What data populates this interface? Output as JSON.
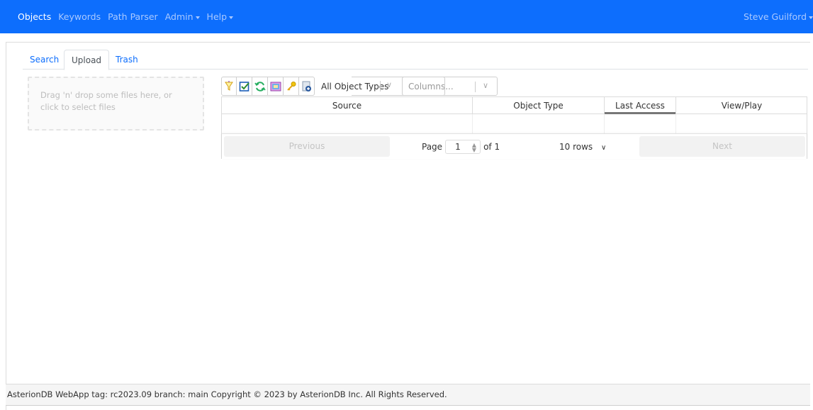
{
  "navbar": {
    "items": [
      {
        "label": "Objects",
        "active": true
      },
      {
        "label": "Keywords",
        "active": false
      },
      {
        "label": "Path Parser",
        "active": false
      },
      {
        "label": "Admin",
        "active": false,
        "dropdown": true
      },
      {
        "label": "Help",
        "active": false,
        "dropdown": true
      }
    ],
    "user": "Steve Guilford"
  },
  "tabs": [
    {
      "label": "Search",
      "active": false
    },
    {
      "label": "Upload",
      "active": true
    },
    {
      "label": "Trash",
      "active": false
    }
  ],
  "dropzone": {
    "text": "Drag 'n' drop some files here, or click to select files"
  },
  "toolbar": {
    "icons": [
      "filter-icon",
      "checkbox-icon",
      "refresh-icon",
      "gallery-icon",
      "key-icon",
      "add-document-icon"
    ],
    "object_type_value": "All Object Types",
    "columns_placeholder": "Columns..."
  },
  "table": {
    "columns": [
      "Source",
      "Object Type",
      "Last Access",
      "View/Play"
    ],
    "sorted_column": "Last Access"
  },
  "pagination": {
    "previous": "Previous",
    "page_label": "Page",
    "page_value": "1",
    "of_label": "of 1",
    "rows_option": "10 rows",
    "next": "Next"
  },
  "footer": {
    "text": "AsterionDB WebApp tag: rc2023.09 branch: main Copyright © 2023 by AsterionDB Inc. All Rights Reserved."
  },
  "colors": {
    "navbar": "#0d6efd",
    "link": "#0d6efd"
  }
}
